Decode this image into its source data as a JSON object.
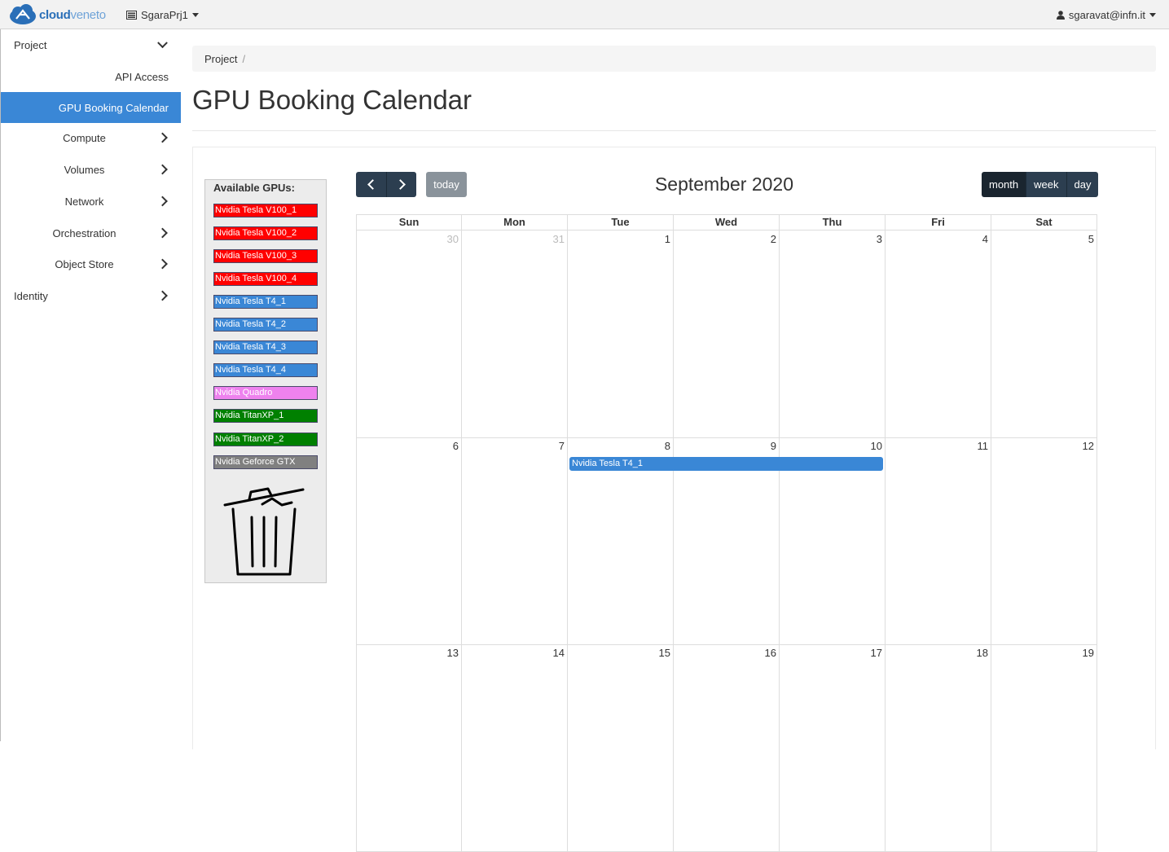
{
  "topbar": {
    "logo_main": "cloud",
    "logo_accent": "veneto",
    "project_name": "SgaraPrj1",
    "user": "sgaravat@infn.it"
  },
  "sidebar": {
    "items": [
      {
        "label": "Project",
        "chevron": "down"
      },
      {
        "label": "API Access"
      },
      {
        "label": "GPU Booking Calendar",
        "active": true
      },
      {
        "label": "Compute",
        "chevron": "right"
      },
      {
        "label": "Volumes",
        "chevron": "right"
      },
      {
        "label": "Network",
        "chevron": "right"
      },
      {
        "label": "Orchestration",
        "chevron": "right"
      },
      {
        "label": "Object Store",
        "chevron": "right"
      },
      {
        "label": "Identity",
        "chevron": "right"
      }
    ]
  },
  "breadcrumb": {
    "item": "Project",
    "separator": "/"
  },
  "page_title": "GPU Booking Calendar",
  "gpus": {
    "heading": "Available GPUs:",
    "items": [
      {
        "label": "Nvidia Tesla V100_1",
        "color": "#ff0000"
      },
      {
        "label": "Nvidia Tesla V100_2",
        "color": "#ff0000"
      },
      {
        "label": "Nvidia Tesla V100_3",
        "color": "#ff0000"
      },
      {
        "label": "Nvidia Tesla V100_4",
        "color": "#ff0000"
      },
      {
        "label": "Nvidia Tesla T4_1",
        "color": "#3a87d6"
      },
      {
        "label": "Nvidia Tesla T4_2",
        "color": "#3a87d6"
      },
      {
        "label": "Nvidia Tesla T4_3",
        "color": "#3a87d6"
      },
      {
        "label": "Nvidia Tesla T4_4",
        "color": "#3a87d6"
      },
      {
        "label": "Nvidia Quadro",
        "color": "#ee82ee"
      },
      {
        "label": "Nvidia TitanXP_1",
        "color": "#008000"
      },
      {
        "label": "Nvidia TitanXP_2",
        "color": "#008000"
      },
      {
        "label": "Nvidia Geforce GTX",
        "color": "#808080"
      }
    ]
  },
  "calendar": {
    "title": "September 2020",
    "today_label": "today",
    "views": [
      {
        "label": "month",
        "active": true
      },
      {
        "label": "week"
      },
      {
        "label": "day"
      }
    ],
    "weekdays": [
      "Sun",
      "Mon",
      "Tue",
      "Wed",
      "Thu",
      "Fri",
      "Sat"
    ],
    "weeks": [
      [
        {
          "day": "30",
          "other": true
        },
        {
          "day": "31",
          "other": true
        },
        {
          "day": "1"
        },
        {
          "day": "2"
        },
        {
          "day": "3"
        },
        {
          "day": "4"
        },
        {
          "day": "5"
        }
      ],
      [
        {
          "day": "6"
        },
        {
          "day": "7"
        },
        {
          "day": "8"
        },
        {
          "day": "9"
        },
        {
          "day": "10"
        },
        {
          "day": "11"
        },
        {
          "day": "12"
        }
      ],
      [
        {
          "day": "13"
        },
        {
          "day": "14"
        },
        {
          "day": "15"
        },
        {
          "day": "16"
        },
        {
          "day": "17"
        },
        {
          "day": "18"
        },
        {
          "day": "19"
        }
      ]
    ],
    "events": [
      {
        "title": "Nvidia Tesla T4_1",
        "start": "2020-09-08",
        "end": "2020-09-10",
        "color": "#3a87d6"
      }
    ]
  }
}
